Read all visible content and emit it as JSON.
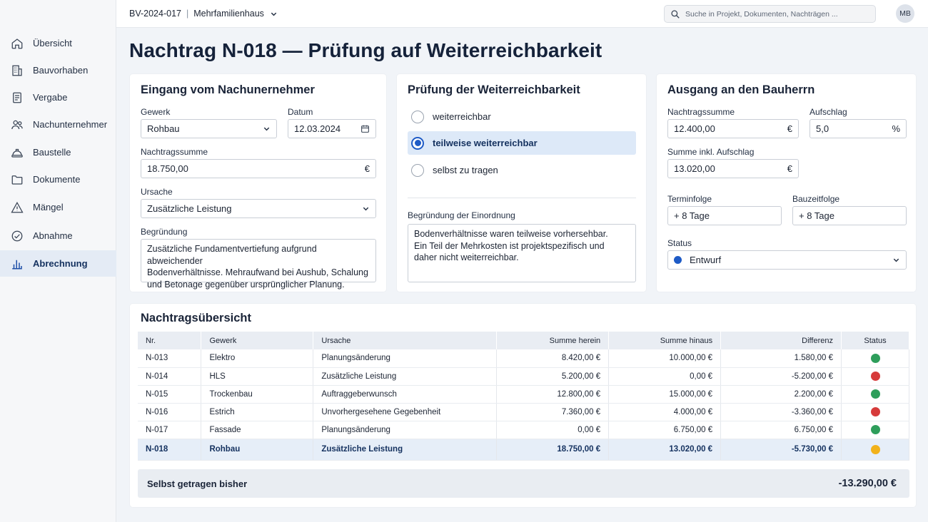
{
  "topbar": {
    "project_id": "BV-2024-017",
    "project_name": "Mehrfamilienhaus",
    "search_placeholder": "Suche in Projekt, Dokumenten, Nachträgen ...",
    "avatar": "MB"
  },
  "sidebar": {
    "items": [
      {
        "label": "Übersicht",
        "icon": "home-icon"
      },
      {
        "label": "Bauvorhaben",
        "icon": "building-icon"
      },
      {
        "label": "Vergabe",
        "icon": "document-icon"
      },
      {
        "label": "Nachunternehmer",
        "icon": "users-icon"
      },
      {
        "label": "Baustelle",
        "icon": "helmet-icon"
      },
      {
        "label": "Dokumente",
        "icon": "folder-icon"
      },
      {
        "label": "Mängel",
        "icon": "warning-icon"
      },
      {
        "label": "Abnahme",
        "icon": "check-circle-icon"
      },
      {
        "label": "Abrechnung",
        "icon": "bar-chart-icon",
        "active": true
      }
    ]
  },
  "page": {
    "title": "Nachtrag N-018 — Prüfung auf Weiterreichbarkeit"
  },
  "eingang": {
    "title": "Eingang vom Nachunernehmer",
    "gewerk_label": "Gewerk",
    "gewerk_value": "Rohbau",
    "datum_label": "Datum",
    "datum_value": "12.03.2024",
    "summe_label": "Nachtragssumme",
    "summe_value": "18.750,00",
    "summe_unit": "€",
    "ursache_label": "Ursache",
    "ursache_value": "Zusätzliche Leistung",
    "begruendung_label": "Begründung",
    "begruendung_lines": [
      "Zusätzliche Fundamentvertiefung aufgrund abweichender",
      "Bodenverhältnisse. Mehraufwand bei Aushub, Schalung",
      "und Betonage gegenüber ursprünglicher Planung."
    ]
  },
  "pruefung": {
    "title": "Prüfung der Weiterreichbarkeit",
    "options": [
      {
        "label": "weiterreichbar",
        "checked": false
      },
      {
        "label": "teilweise weiterreichbar",
        "checked": true
      },
      {
        "label": "selbst zu tragen",
        "checked": false
      }
    ],
    "begruendung_label": "Begründung der Einordnung",
    "begruendung_lines": [
      "Bodenverhältnisse waren teilweise vorhersehbar.",
      "Ein Teil der Mehrkosten ist projektspezifisch und",
      "daher nicht weiterreichbar."
    ]
  },
  "ausgang": {
    "title": "Ausgang an den Bauherrn",
    "summe_label": "Nachtragssumme",
    "summe_value": "12.400,00",
    "summe_unit": "€",
    "aufschlag_label": "Aufschlag",
    "aufschlag_value": "5,0",
    "aufschlag_unit": "%",
    "inkl_label": "Summe inkl. Aufschlag",
    "inkl_value": "13.020,00",
    "inkl_unit": "€",
    "terminfolge_label": "Terminfolge",
    "terminfolge_value": "+ 8 Tage",
    "bauzeitfolge_label": "Bauzeitfolge",
    "bauzeitfolge_value": "+ 8 Tage",
    "status_label": "Status",
    "status_value": "Entwurf",
    "status_color": "#1e5bc6"
  },
  "uebersicht": {
    "title": "Nachtragsübersicht",
    "columns": [
      "Nr.",
      "Gewerk",
      "Ursache",
      "Summe herein",
      "Summe hinaus",
      "Differenz",
      "Status"
    ],
    "rows": [
      {
        "nr": "N-013",
        "gewerk": "Elektro",
        "ursache": "Planungsänderung",
        "herein": "8.420,00 €",
        "hinaus": "10.000,00 €",
        "diff": "1.580,00 €",
        "status": "green"
      },
      {
        "nr": "N-014",
        "gewerk": "HLS",
        "ursache": "Zusätzliche Leistung",
        "herein": "5.200,00 €",
        "hinaus": "0,00 €",
        "diff": "-5.200,00 €",
        "status": "red"
      },
      {
        "nr": "N-015",
        "gewerk": "Trockenbau",
        "ursache": "Auftraggeberwunsch",
        "herein": "12.800,00 €",
        "hinaus": "15.000,00 €",
        "diff": "2.200,00 €",
        "status": "green"
      },
      {
        "nr": "N-016",
        "gewerk": "Estrich",
        "ursache": "Unvorhergesehene Gegebenheit",
        "herein": "7.360,00 €",
        "hinaus": "4.000,00 €",
        "diff": "-3.360,00 €",
        "status": "red"
      },
      {
        "nr": "N-017",
        "gewerk": "Fassade",
        "ursache": "Planungsänderung",
        "herein": "0,00 €",
        "hinaus": "6.750,00 €",
        "diff": "6.750,00 €",
        "status": "green"
      },
      {
        "nr": "N-018",
        "gewerk": "Rohbau",
        "ursache": "Zusätzliche Leistung",
        "herein": "18.750,00 €",
        "hinaus": "13.020,00 €",
        "diff": "-5.730,00 €",
        "status": "yellow",
        "highlight": true
      }
    ],
    "status_colors": {
      "green": "#2e9e5b",
      "red": "#d63b3b",
      "yellow": "#f2b21b"
    },
    "summary_label": "Selbst getragen bisher",
    "summary_value": "-13.290,00 €"
  }
}
